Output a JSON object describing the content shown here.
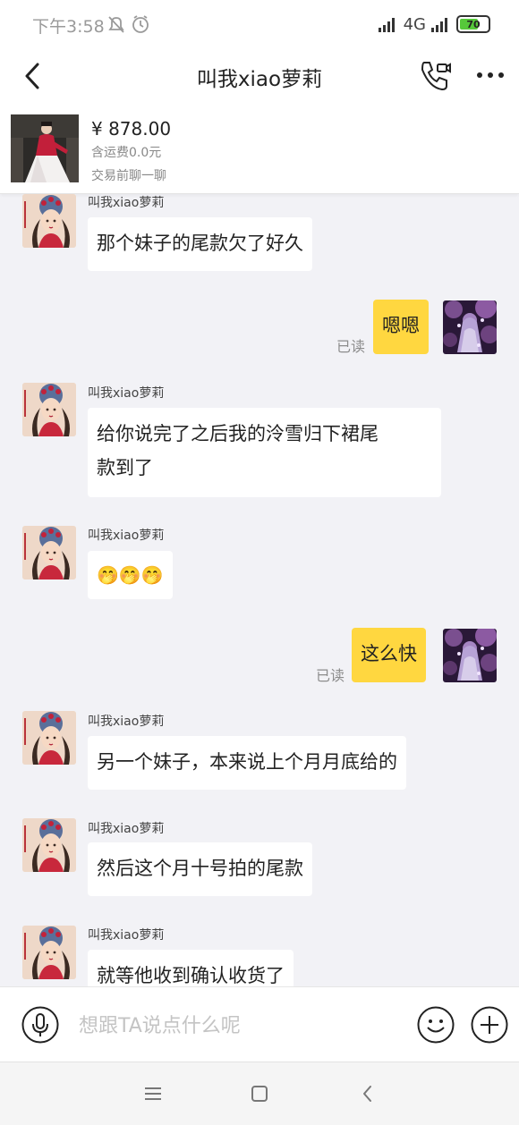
{
  "status_bar": {
    "time": "下午3:58",
    "network": "4G",
    "battery": "70",
    "battery_level": 0.7
  },
  "header": {
    "title": "叫我xiao萝莉"
  },
  "product": {
    "price": "¥ 878.00",
    "shipping": "含运费0.0元",
    "tip": "交易前聊一聊"
  },
  "messages": [
    {
      "side": "left",
      "sender": "叫我xiao萝莉",
      "text": "那个妹子的尾款欠了好久"
    },
    {
      "side": "right",
      "text": "嗯嗯",
      "status": "已读"
    },
    {
      "side": "left",
      "sender": "叫我xiao萝莉",
      "text": "给你说完了之后我的泠雪归下裙尾",
      "text2": "款到了"
    },
    {
      "side": "left",
      "sender": "叫我xiao萝莉",
      "text": "🤭🤭🤭"
    },
    {
      "side": "right",
      "text": "这么快",
      "status": "已读"
    },
    {
      "side": "left",
      "sender": "叫我xiao萝莉",
      "text": "另一个妹子，本来说上个月月底给的"
    },
    {
      "side": "left",
      "sender": "叫我xiao萝莉",
      "text": "然后这个月十号拍的尾款"
    },
    {
      "side": "left",
      "sender": "叫我xiao萝莉",
      "text": "就等他收到确认收货了"
    }
  ],
  "input": {
    "placeholder": "想跟TA说点什么呢"
  },
  "icons": {
    "back": "back-icon",
    "call": "video-call-icon",
    "more": "more-icon",
    "voice": "microphone-icon",
    "emoji": "smiley-icon",
    "plus": "plus-icon",
    "nav_menu": "menu-icon",
    "nav_home": "home-icon",
    "nav_back": "back-triangle-icon",
    "mute": "bell-off-icon",
    "alarm": "alarm-icon",
    "signal": "signal-icon",
    "battery": "battery-icon"
  },
  "colors": {
    "my_bubble": "#ffd740",
    "other_bubble": "#ffffff",
    "background": "#f2f2f6",
    "battery_fill": "#56c83a"
  }
}
